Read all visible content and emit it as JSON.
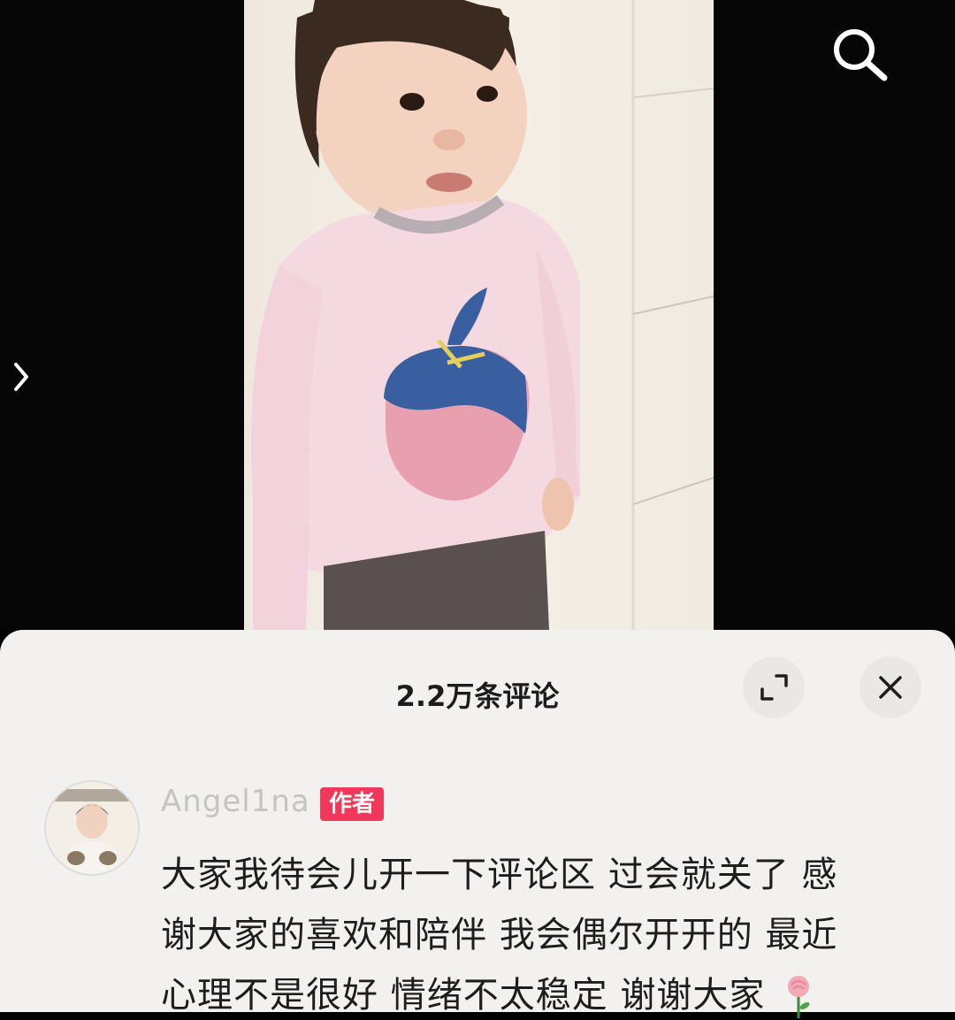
{
  "video": {
    "search_icon": "search-icon",
    "expand_icon": "chevron-right-icon"
  },
  "comments_panel": {
    "title": "2.2万条评论",
    "fullscreen_icon": "fullscreen-icon",
    "close_icon": "close-icon"
  },
  "comment": {
    "username": "Angel1na",
    "badge": "作者",
    "text_lines": [
      "大家我待会儿开一下评论区 过会就关了 感",
      "谢大家的喜欢和陪伴 我会偶尔开开的 最近",
      "心理不是很好 情绪不太稳定 谢谢大家"
    ],
    "emoji": "rose-icon"
  },
  "colors": {
    "badge": "#f2385a",
    "sheet_bg": "#f2f1f0",
    "username": "#c4c4c4"
  }
}
